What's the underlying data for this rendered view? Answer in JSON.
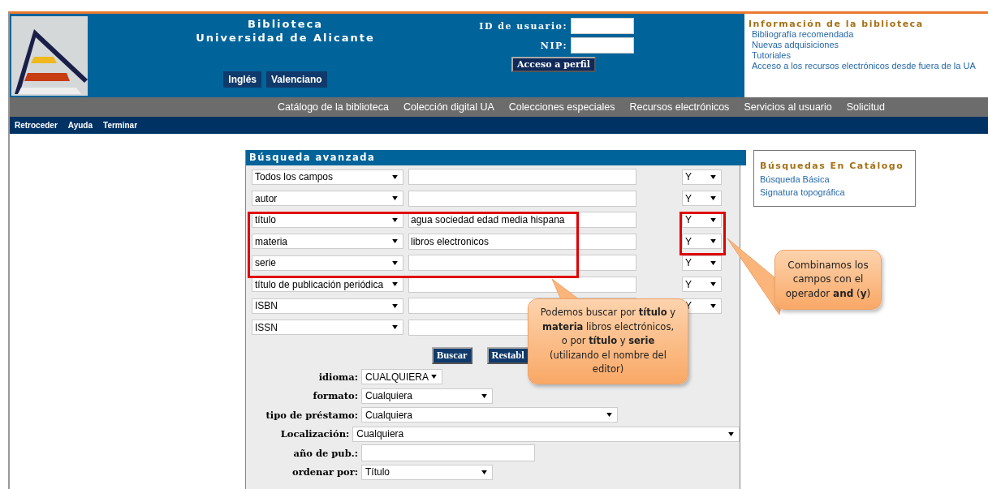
{
  "header": {
    "title_lines": [
      "Biblioteca",
      "Universidad de Alicante"
    ],
    "language_buttons": [
      "Inglés",
      "Valenciano"
    ],
    "login": {
      "user_label": "ID de usuario:",
      "pin_label": "NIP:",
      "button": "Acceso a perfil"
    },
    "info": {
      "title": "Información de la biblioteca",
      "links": [
        "Bibliografía recomendada",
        "Nuevas adquisiciones",
        "Tutoriales",
        "Acceso a los recursos electrónicos desde fuera de la UA"
      ]
    }
  },
  "nav": [
    "Catálogo de la biblioteca",
    "Colección digital UA",
    "Colecciones especiales",
    "Recursos electrónicos",
    "Servicios al usuario",
    "Solicitud"
  ],
  "toolbar": [
    "Retroceder",
    "Ayuda",
    "Terminar"
  ],
  "search": {
    "title": "Búsqueda avanzada",
    "rows": [
      {
        "field": "Todos los campos",
        "operator": "Y"
      },
      {
        "field": "autor",
        "operator": "Y"
      },
      {
        "field": "título",
        "value": "agua sociedad edad media hispana",
        "operator": "Y"
      },
      {
        "field": "materia",
        "value": "libros electronicos",
        "operator": "Y"
      },
      {
        "field": "serie",
        "operator": "Y"
      },
      {
        "field": "título de publicación periódica",
        "operator": "Y"
      },
      {
        "field": "ISBN",
        "operator": "Y"
      },
      {
        "field": "ISSN"
      }
    ],
    "buttons": [
      "Buscar",
      "Restabl"
    ],
    "filters": [
      {
        "label": "idioma:",
        "kind": "select",
        "value": "CUALQUIERA"
      },
      {
        "label": "formato:",
        "kind": "select",
        "value": "Cualquiera"
      },
      {
        "label": "tipo de préstamo:",
        "kind": "select",
        "value": "Cualquiera"
      },
      {
        "label": "Localización:",
        "kind": "select",
        "value": "Cualquiera"
      },
      {
        "label": "año de pub.:",
        "kind": "input"
      },
      {
        "label": "ordenar por:",
        "kind": "select",
        "value": "Título"
      }
    ]
  },
  "side_box": {
    "title": "Búsquedas En Catálogo",
    "links": [
      "Búsqueda Básica",
      "Signatura topográfica"
    ]
  },
  "callouts": [
    {
      "text": "Podemos buscar por **título** y **materia** libros electrónicos, o por **título** y **serie** (utilizando el nombre del editor)"
    },
    {
      "text": "Combinamos los campos con el operador **and** (**y**)"
    }
  ]
}
